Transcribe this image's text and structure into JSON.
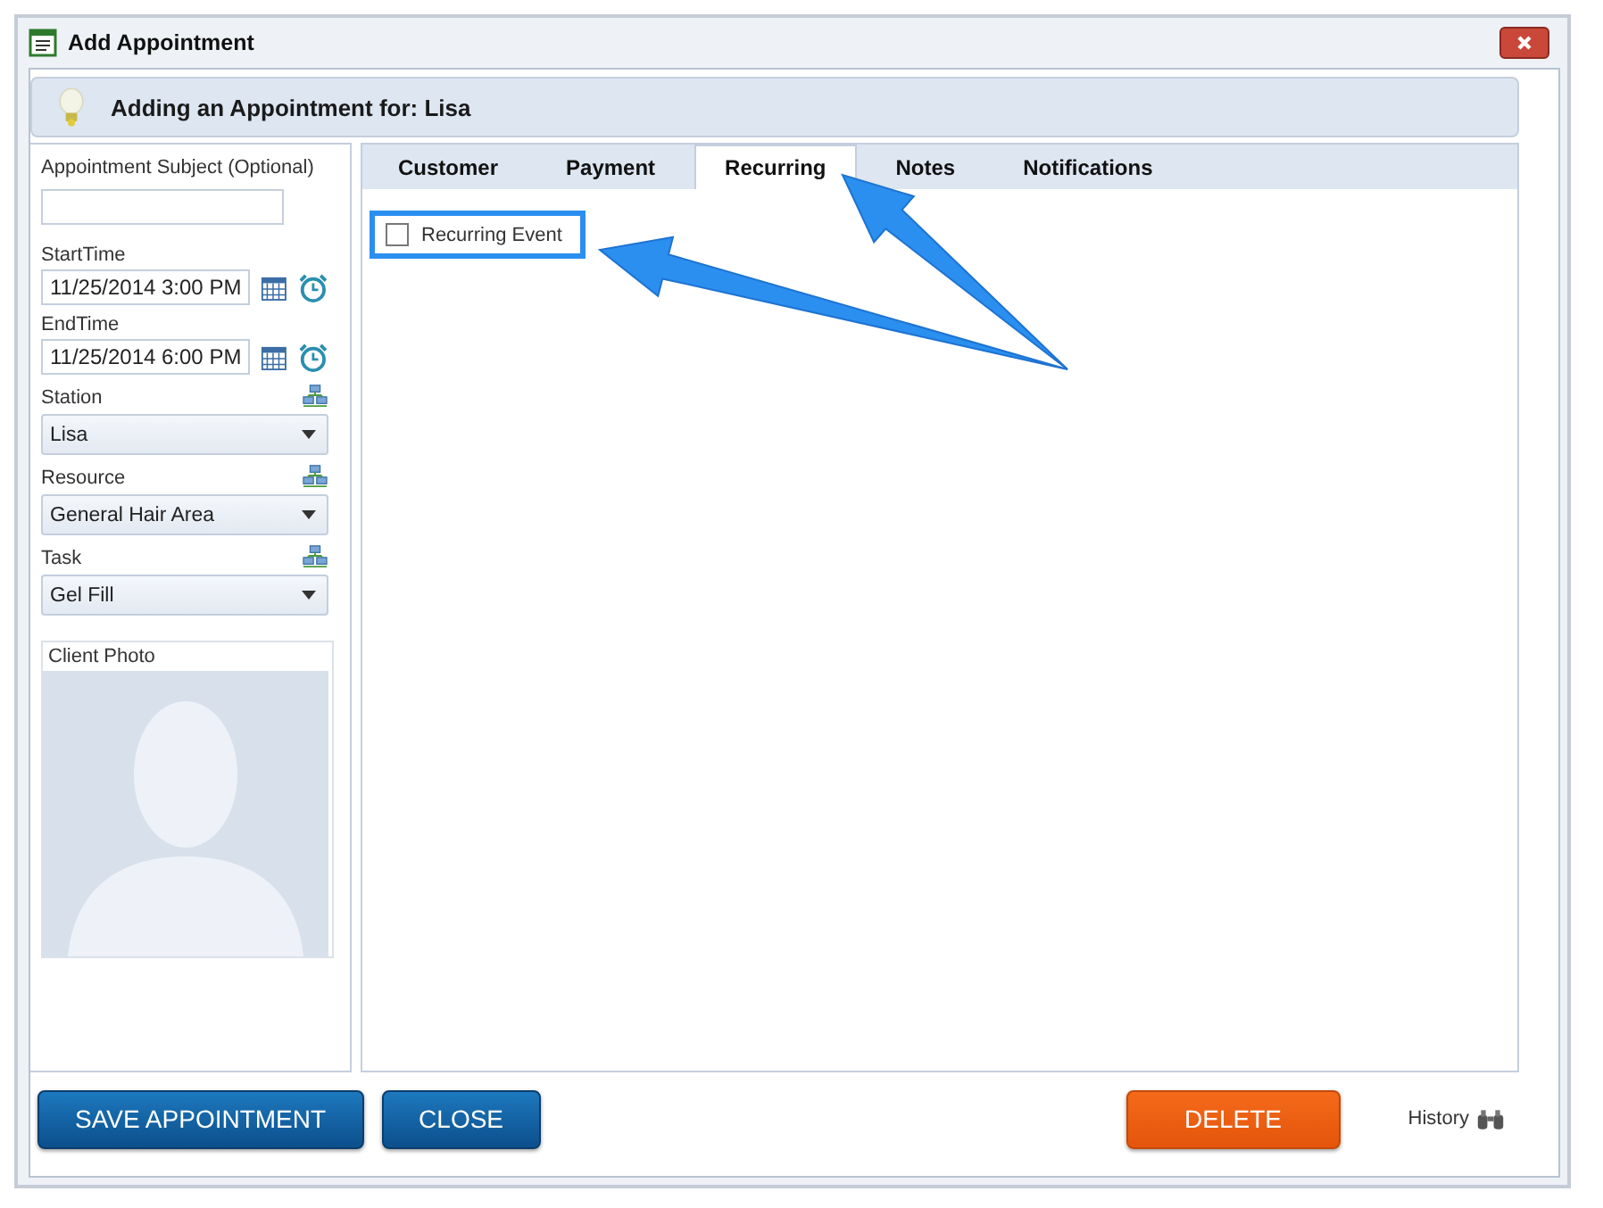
{
  "window": {
    "title": "Add Appointment"
  },
  "header": {
    "text": "Adding an Appointment for: Lisa"
  },
  "form": {
    "subject": {
      "label": "Appointment Subject (Optional)"
    },
    "times": [
      {
        "label": "StartTime",
        "value": "11/25/2014 3:00 PM"
      },
      {
        "label": "EndTime",
        "value": "11/25/2014 6:00 PM"
      }
    ],
    "selects": [
      {
        "label": "Station",
        "value": "Lisa"
      },
      {
        "label": "Resource",
        "value": "General Hair Area"
      },
      {
        "label": "Task",
        "value": "Gel Fill"
      }
    ],
    "photo": {
      "label": "Client Photo"
    }
  },
  "tabs": [
    {
      "label": "Customer",
      "selected": false
    },
    {
      "label": "Payment",
      "selected": false
    },
    {
      "label": "Recurring",
      "selected": true
    },
    {
      "label": "Notes",
      "selected": false
    },
    {
      "label": "Notifications",
      "selected": false
    }
  ],
  "recurring": {
    "label": "Recurring Event",
    "checked": false
  },
  "buttons": [
    {
      "label": "SAVE APPOINTMENT",
      "kind": "primary"
    },
    {
      "label": "CLOSE",
      "kind": "primary"
    },
    {
      "label": "DELETE",
      "kind": "danger"
    }
  ],
  "history": {
    "label": "History"
  }
}
